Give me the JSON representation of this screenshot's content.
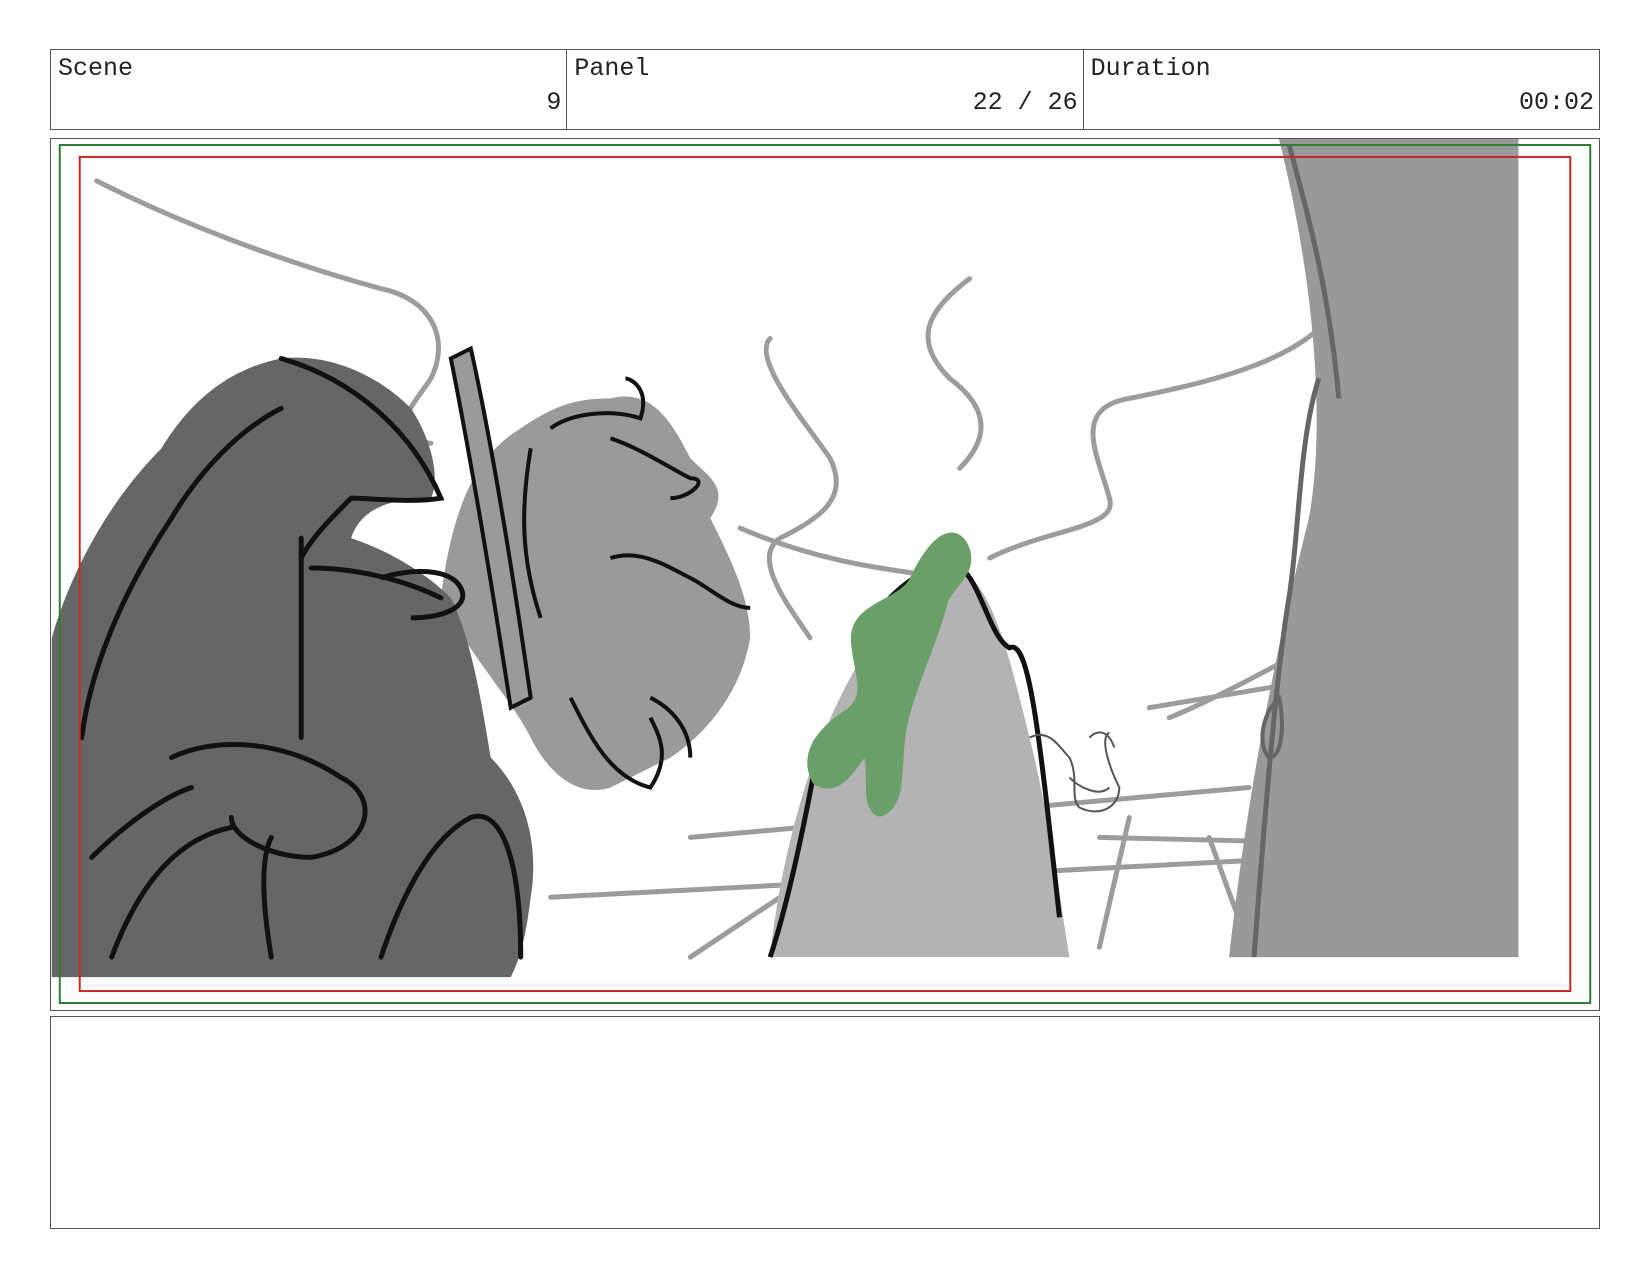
{
  "header": {
    "scene": {
      "label": "Scene",
      "value": "9"
    },
    "panel": {
      "label": "Panel",
      "value": "22 / 26"
    },
    "duration": {
      "label": "Duration",
      "value": "00:02"
    }
  },
  "colors": {
    "safe_frame_outer": "#2e7d32",
    "safe_frame_inner": "#c62828",
    "dark_figure": "#666666",
    "light_figure": "#9a9a9a",
    "rock": "#b3b3b3",
    "vine": "#6a9f6a",
    "ink": "#111111"
  },
  "notes": {
    "text": ""
  }
}
